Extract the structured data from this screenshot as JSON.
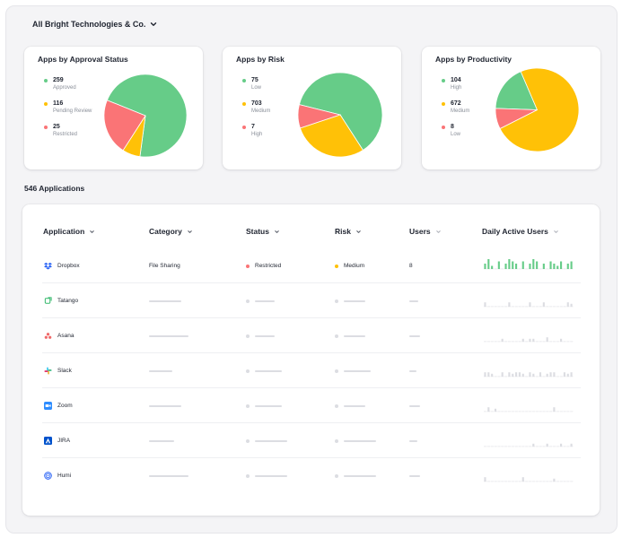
{
  "org_selector": {
    "label": "All Bright Technologies & Co."
  },
  "colors": {
    "green": "#66cc88",
    "yellow": "#ffc107",
    "red": "#fa7476",
    "placeholder": "#dcdde2"
  },
  "approval_card": {
    "title": "Apps by Approval Status",
    "items": [
      {
        "value": "259",
        "label": "Approved",
        "color": "#66cc88"
      },
      {
        "value": "116",
        "label": "Pending Review",
        "color": "#ffc107"
      },
      {
        "value": "25",
        "label": "Restricted",
        "color": "#fa7476"
      }
    ]
  },
  "risk_card": {
    "title": "Apps by Risk",
    "items": [
      {
        "value": "75",
        "label": "Low",
        "color": "#66cc88"
      },
      {
        "value": "703",
        "label": "Medium",
        "color": "#ffc107"
      },
      {
        "value": "7",
        "label": "High",
        "color": "#fa7476"
      }
    ]
  },
  "productivity_card": {
    "title": "Apps by Productivity",
    "items": [
      {
        "value": "104",
        "label": "High",
        "color": "#66cc88"
      },
      {
        "value": "672",
        "label": "Medium",
        "color": "#ffc107"
      },
      {
        "value": "8",
        "label": "Low",
        "color": "#fa7476"
      }
    ]
  },
  "chart_data": [
    {
      "type": "pie",
      "categories": [
        "Approved",
        "Pending Review",
        "Restricted"
      ],
      "values": [
        71,
        7,
        22
      ],
      "colors": [
        "#66cc88",
        "#ffc107",
        "#fa7476"
      ]
    },
    {
      "type": "pie",
      "categories": [
        "Low",
        "Medium",
        "High"
      ],
      "values": [
        62,
        29,
        9
      ],
      "colors": [
        "#66cc88",
        "#ffc107",
        "#fa7476"
      ]
    },
    {
      "type": "pie",
      "categories": [
        "High",
        "Medium",
        "Low"
      ],
      "values": [
        18,
        74,
        8
      ],
      "colors": [
        "#66cc88",
        "#ffc107",
        "#fa7476"
      ]
    }
  ],
  "applications_count_label": "546 Applications",
  "table": {
    "headers": {
      "application": "Application",
      "category": "Category",
      "status": "Status",
      "risk": "Risk",
      "users": "Users",
      "daily_active_users": "Daily Active Users"
    },
    "first_row": {
      "name": "Dropbox",
      "icon": "dropbox-icon",
      "category": "File Sharing",
      "status": "Restricted",
      "status_color": "#fa7476",
      "risk": "Medium",
      "risk_color": "#ffc107",
      "users": "8",
      "dau_bars": [
        2,
        4,
        1,
        0,
        3,
        0,
        2,
        4,
        3,
        2,
        0,
        3,
        0,
        2,
        4,
        3,
        0,
        2,
        0,
        3,
        2,
        1,
        3,
        0,
        2,
        3
      ]
    },
    "rows": [
      {
        "name": "Tatango",
        "icon": "tatango-icon",
        "dau_bars": [
          3,
          0,
          0,
          0,
          0,
          0,
          0,
          3,
          0,
          0,
          0,
          0,
          0,
          3,
          0,
          0,
          0,
          3,
          0,
          0,
          0,
          0,
          0,
          0,
          3,
          2
        ]
      },
      {
        "name": "Asana",
        "icon": "asana-icon",
        "dau_bars": [
          0,
          0,
          0,
          0,
          0,
          2,
          0,
          0,
          0,
          0,
          0,
          2,
          0,
          2,
          2,
          0,
          0,
          0,
          3,
          0,
          0,
          0,
          2,
          0,
          0,
          0
        ]
      },
      {
        "name": "Slack",
        "icon": "slack-icon",
        "dau_bars": [
          3,
          3,
          2,
          0,
          0,
          3,
          0,
          3,
          2,
          3,
          3,
          2,
          0,
          3,
          2,
          0,
          3,
          0,
          2,
          3,
          3,
          0,
          0,
          3,
          2,
          3
        ]
      },
      {
        "name": "Zoom",
        "icon": "zoom-icon",
        "dau_bars": [
          0,
          3,
          0,
          2,
          0,
          0,
          0,
          0,
          0,
          0,
          0,
          0,
          0,
          0,
          0,
          0,
          0,
          0,
          0,
          0,
          3,
          0,
          0,
          0,
          0,
          0
        ]
      },
      {
        "name": "JIRA",
        "icon": "jira-icon",
        "dau_bars": [
          0,
          0,
          0,
          0,
          0,
          0,
          0,
          0,
          0,
          0,
          0,
          0,
          0,
          0,
          2,
          0,
          0,
          0,
          2,
          0,
          0,
          0,
          2,
          0,
          0,
          2
        ]
      },
      {
        "name": "Humi",
        "icon": "humi-icon",
        "dau_bars": [
          3,
          0,
          0,
          0,
          0,
          0,
          0,
          0,
          0,
          0,
          0,
          3,
          0,
          0,
          0,
          0,
          0,
          0,
          0,
          0,
          2,
          0,
          0,
          0,
          0,
          0
        ]
      }
    ]
  }
}
